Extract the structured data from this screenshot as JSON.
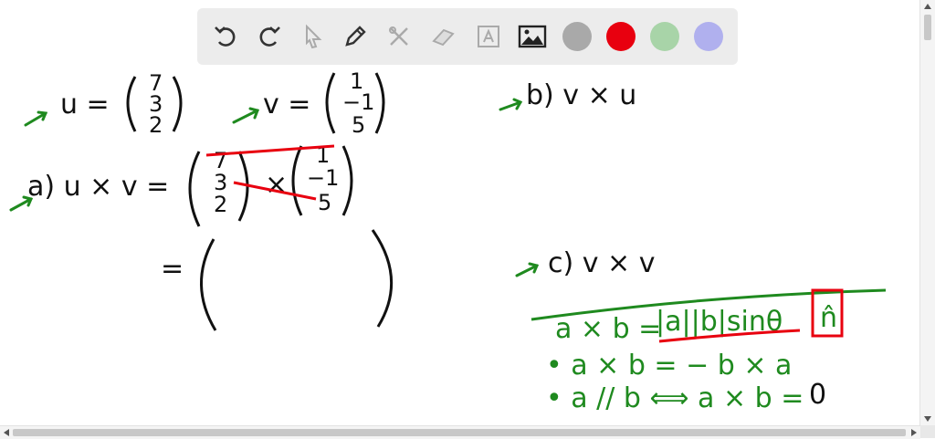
{
  "toolbar": {
    "tools": [
      "undo-icon",
      "redo-icon",
      "pointer-icon",
      "pencil-icon",
      "tools-icon",
      "eraser-icon",
      "text-icon",
      "image-icon"
    ],
    "colors": [
      "#a9a9a9",
      "#e8000f",
      "#a8d4a8",
      "#b0b0ee"
    ]
  },
  "board": {
    "u_label": "u =",
    "u_vec": [
      "7",
      "3",
      "2"
    ],
    "v_label": "v =",
    "v_vec": [
      "1",
      "−1",
      "5"
    ],
    "part_b": "b)  v × u",
    "part_a": "a)  u × v =",
    "a_left": [
      "7",
      "3",
      "2"
    ],
    "a_times": "×",
    "a_right": [
      "1",
      "−1",
      "5"
    ],
    "equals": "=",
    "part_c": "c)  v × v",
    "formula1_lhs": "a × b =",
    "formula1_rhs": "|a||b|sinθ",
    "formula1_hat": "n̂",
    "formula2": "•  a × b  =  − b × a",
    "formula3_lhs": "•  a // b  ⟺  a × b =",
    "formula3_zero": "0"
  }
}
